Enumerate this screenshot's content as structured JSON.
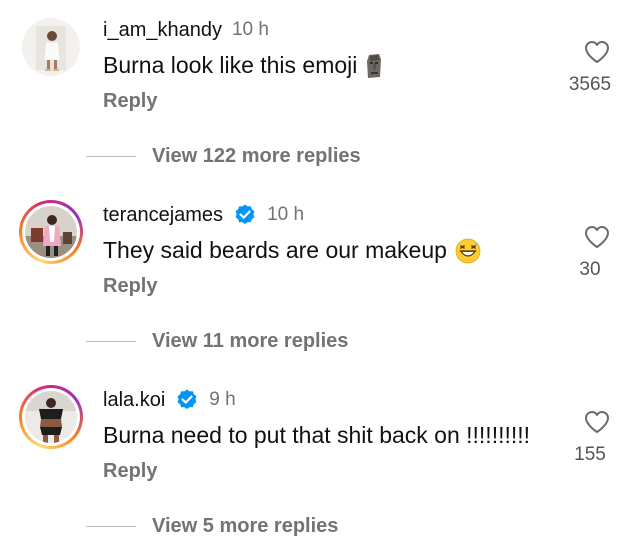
{
  "comments": [
    {
      "username": "i_am_khandy",
      "verified": false,
      "time": "10 h",
      "text": "Burna look like this emoji",
      "emoji": "moai-emoji",
      "reply_label": "Reply",
      "likes": "3565",
      "view_more": "View 122 more replies"
    },
    {
      "username": "terancejames",
      "verified": true,
      "time": "10 h",
      "text": "They said beards are our makeup",
      "emoji": "grinning-sweat-emoji",
      "reply_label": "Reply",
      "likes": "30",
      "view_more": "View 11 more replies"
    },
    {
      "username": "lala.koi",
      "verified": true,
      "time": "9 h",
      "text": "Burna need to put that shit back on !!!!!!!!!!",
      "reply_label": "Reply",
      "likes": "155",
      "view_more": "View 5 more replies"
    }
  ],
  "colors": {
    "verified_blue": "#0095f6",
    "secondary_text": "#737373",
    "primary_text": "#111111"
  },
  "icons": {
    "like": "heart-outline-icon",
    "verified": "verified-badge-icon"
  }
}
